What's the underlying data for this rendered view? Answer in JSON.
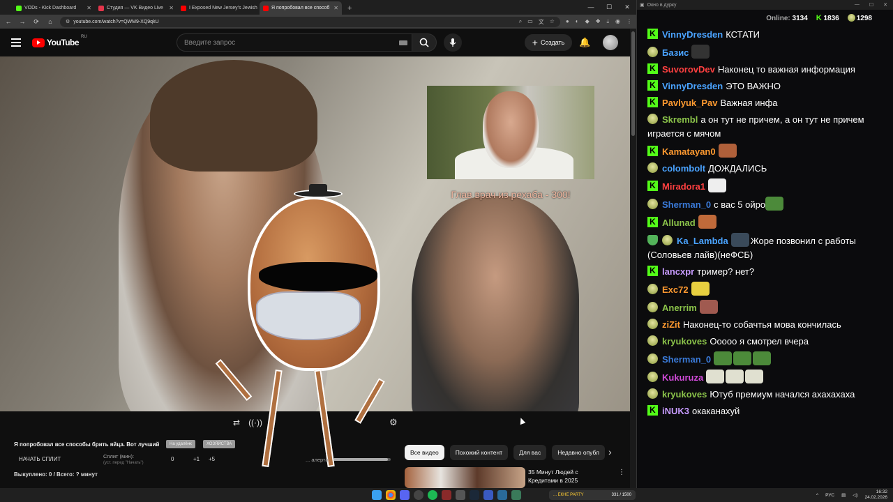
{
  "browser": {
    "tabs": [
      {
        "label": "VODs - Kick Dashboard",
        "color": "#53fc18"
      },
      {
        "label": "Студия — VK Видео Live",
        "color": "#e3354b"
      },
      {
        "label": "I Exposed New Jersey's Jewish",
        "color": "#ff0000"
      },
      {
        "label": "Я попробовал все способ",
        "color": "#ff0000"
      }
    ],
    "url": "youtube.com/watch?v=QWM9-XQ9qkU"
  },
  "youtube": {
    "logo": "YouTube",
    "region": "RU",
    "search_placeholder": "Введите запрос",
    "create_label": "Создать",
    "video_caption": "Глав врач из рехаба - 300!",
    "video_title": "Я попробовал все способы брить яйца. Вот лучший",
    "chips": [
      "На удалёнк",
      "ХОЗЯЙСТВА"
    ],
    "split_button": "НАЧАТЬ СПЛИТ",
    "split_label": "Сплит (мин):",
    "split_sub": "(уст. перед \"Начать\")",
    "split_nums": [
      "0",
      "+1",
      "+5"
    ],
    "alert_label": "... алерта:",
    "alert_level": 0.95,
    "bought": "Выкуплено: 0 / Всего: ? минут",
    "filter_chips": [
      "Все видео",
      "Похожий контент",
      "Для вас",
      "Недавно опубл"
    ],
    "rec_title": "35 Минут Людей с Кредитами в 2025"
  },
  "chat": {
    "window_title": "Окно в дурку",
    "online_label": "Online:",
    "online_count": "3134",
    "kick_count": "1836",
    "other_count": "1298",
    "messages": [
      {
        "badge": "kick",
        "nick": "VinnyDresden",
        "color": "#4aa3ff",
        "text": "КСТАТИ",
        "emotes": []
      },
      {
        "badge": "frog",
        "nick": "Базис",
        "color": "#4aa3ff",
        "text": "",
        "emotes": [
          "#333"
        ]
      },
      {
        "badge": "kick",
        "nick": "SuvorovDev",
        "color": "#ff4040",
        "text": "Наконец то важная информация",
        "emotes": []
      },
      {
        "badge": "kick",
        "nick": "VinnyDresden",
        "color": "#4aa3ff",
        "text": "ЭТО ВАЖНО",
        "emotes": []
      },
      {
        "badge": "kick",
        "nick": "Pavlyuk_Pav",
        "color": "#ff9a30",
        "text": "Важная инфа",
        "emotes": []
      },
      {
        "badge": "frog",
        "nick": "Skrembl",
        "color": "#8bc34a",
        "text": "а он тут не причем, а он тут не причем играется с мячом",
        "emotes": []
      },
      {
        "badge": "kick",
        "nick": "Kamatayan0",
        "color": "#ff9a30",
        "text": "",
        "emotes": [
          "#b0603a"
        ]
      },
      {
        "badge": "frog",
        "nick": "colombolt",
        "color": "#4aa3ff",
        "text": "ДОЖДАЛИСЬ",
        "emotes": []
      },
      {
        "badge": "kick",
        "nick": "Miradora1",
        "color": "#ff4040",
        "text": "",
        "emotes": [
          "#eeeeee"
        ]
      },
      {
        "badge": "frog",
        "nick": "Sherman_0",
        "color": "#3a7ad8",
        "text": "с вас 5 ойро",
        "emotes": [
          "#4c8a3a"
        ]
      },
      {
        "badge": "kick",
        "nick": "Allunad",
        "color": "#8bc34a",
        "text": "",
        "emotes": [
          "#c06a3a"
        ]
      },
      {
        "badge": "shield",
        "nick": "Ka_Lambda",
        "color": "#4aa3ff",
        "text": "Жоре позвонил с работы (Соловьев лайв)(неФСБ)",
        "emotes": [
          "#3a4a5a"
        ]
      },
      {
        "badge": "kick",
        "nick": "lancxpr",
        "color": "#c79bff",
        "text": "тример? нет?",
        "emotes": []
      },
      {
        "badge": "frog",
        "nick": "Exc72",
        "color": "#ff9a30",
        "text": "",
        "emotes": [
          "#e8d040"
        ]
      },
      {
        "badge": "frog",
        "nick": "Anerrim",
        "color": "#8bc34a",
        "text": "",
        "emotes": [
          "#a05a50"
        ]
      },
      {
        "badge": "frog",
        "nick": "ziZit",
        "color": "#ff9a30",
        "text": "Наконец-то собачтья мова кончилась",
        "emotes": []
      },
      {
        "badge": "frog",
        "nick": "kryukoves",
        "color": "#8bc34a",
        "text": "Ооооо я смотрел вчера",
        "emotes": []
      },
      {
        "badge": "frog",
        "nick": "Sherman_0",
        "color": "#3a7ad8",
        "text": "",
        "emotes": [
          "#4c8a3a",
          "#4c8a3a",
          "#4c8a3a"
        ]
      },
      {
        "badge": "frog",
        "nick": "Kukuruza",
        "color": "#d04ad8",
        "text": "",
        "emotes": [
          "#e0e0d0",
          "#e0e0d0",
          "#e0e0d0"
        ]
      },
      {
        "badge": "frog",
        "nick": "kryukoves",
        "color": "#8bc34a",
        "text": "Ютуб премиум начался ахахахаха",
        "emotes": []
      },
      {
        "badge": "kick",
        "nick": "iNUK3",
        "color": "#c79bff",
        "text": "окаканахуй",
        "emotes": []
      }
    ]
  },
  "taskbar": {
    "widget_label": "... ЕКНЕ PARTY",
    "widget_count": "331 / 1500",
    "lang": "РУС",
    "time": "16:32",
    "date": "24.02.2026"
  }
}
